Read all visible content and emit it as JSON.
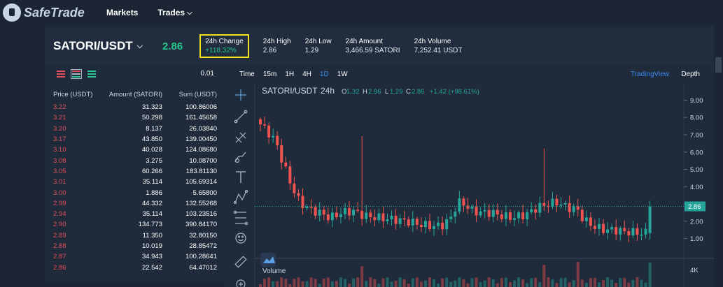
{
  "nav": {
    "brand": "SafeTrade",
    "markets": "Markets",
    "trades": "Trades"
  },
  "header": {
    "pair": "SATORI/USDT",
    "last_price": "2.86",
    "change_label": "24h Change",
    "change_value": "+118.32%",
    "high_label": "24h High",
    "high_value": "2.86",
    "low_label": "24h Low",
    "low_value": "1.29",
    "amount_label": "24h Amount",
    "amount_value": "3,466.59 SATORI",
    "volume_label": "24h Volume",
    "volume_value": "7,252.41 USDT"
  },
  "orderbook": {
    "precision": "0.01",
    "columns": [
      "Price (USDT)",
      "Amount (SATORI)",
      "Sum (USDT)"
    ],
    "rows": [
      [
        "3.22",
        "31.323",
        "100.86006"
      ],
      [
        "3.21",
        "50.298",
        "161.45658"
      ],
      [
        "3.20",
        "8.137",
        "26.03840"
      ],
      [
        "3.17",
        "43.850",
        "139.00450"
      ],
      [
        "3.10",
        "40.028",
        "124.08680"
      ],
      [
        "3.08",
        "3.275",
        "10.08700"
      ],
      [
        "3.05",
        "60.266",
        "183.81130"
      ],
      [
        "3.01",
        "35.114",
        "105.69314"
      ],
      [
        "3.00",
        "1.886",
        "5.65800"
      ],
      [
        "2.99",
        "44.332",
        "132.55268"
      ],
      [
        "2.94",
        "35.114",
        "103.23516"
      ],
      [
        "2.90",
        "134.773",
        "390.84170"
      ],
      [
        "2.89",
        "11.350",
        "32.80150"
      ],
      [
        "2.88",
        "10.019",
        "28.85472"
      ],
      [
        "2.87",
        "34.943",
        "100.28641"
      ],
      [
        "2.86",
        "22.542",
        "64.47012"
      ]
    ],
    "sell_color": "#e0505c"
  },
  "chart": {
    "timeframes": [
      "Time",
      "15m",
      "1H",
      "4H",
      "1D",
      "1W"
    ],
    "active_timeframe": "1D",
    "tradingview": "TradingView",
    "depth": "Depth",
    "legend_pair": "SATORI/USDT",
    "legend_interval": "24h",
    "legend_o": "O",
    "legend_o_val": "1.32",
    "legend_h": "H",
    "legend_h_val": "2.86",
    "legend_l": "L",
    "legend_l_val": "1.29",
    "legend_c": "C",
    "legend_c_val": "2.86",
    "legend_change": "+1.42 (+98.61%)",
    "volume_label": "Volume",
    "price_tag": "2.86",
    "up_color": "#26a69a",
    "down_color": "#ef5350"
  },
  "chart_data": {
    "type": "candlestick",
    "y_ticks": [
      "9.00",
      "8.00",
      "7.00",
      "6.00",
      "5.00",
      "4.00",
      "3.00",
      "2.00",
      "1.00"
    ],
    "ylim": [
      0.5,
      9.3
    ],
    "volume_ticks": [
      "4K"
    ],
    "last_price": 2.86
  }
}
